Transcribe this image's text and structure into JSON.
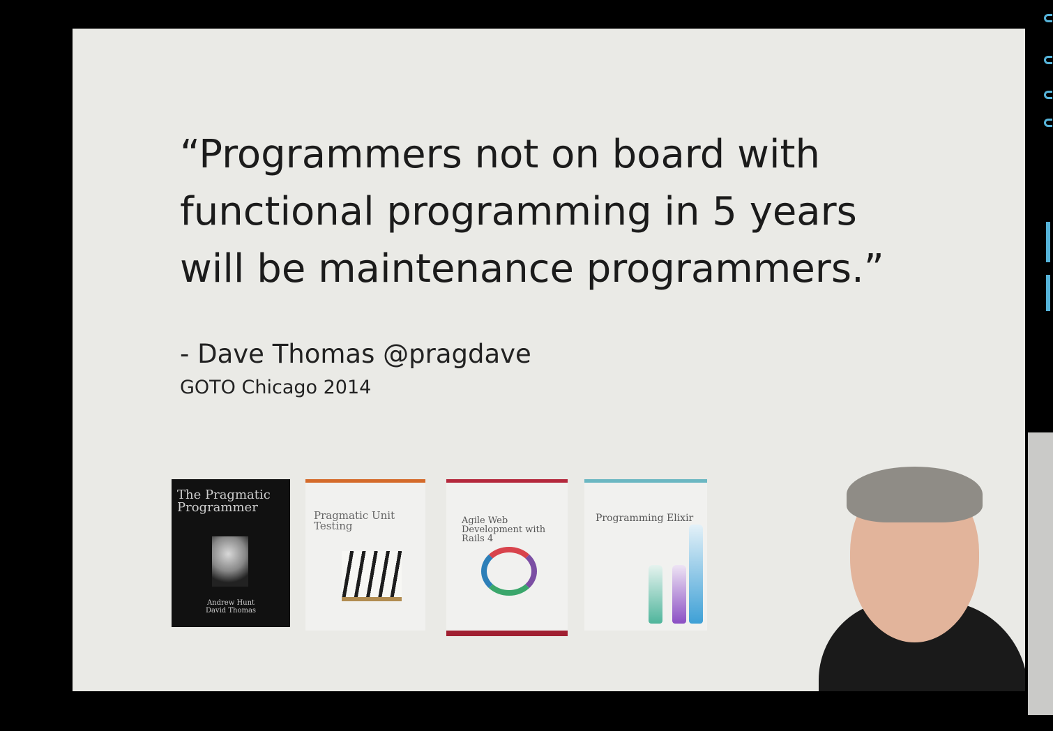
{
  "slide": {
    "quote_lines": [
      "“Programmers not on board with",
      "functional programming in 5 years",
      "will be maintenance programmers.”"
    ],
    "author": "- Dave Thomas @pragdave",
    "event": "GOTO Chicago 2014"
  },
  "books": [
    {
      "title": "The Pragmatic Programmer",
      "authors": "Andrew Hunt David Thomas"
    },
    {
      "title": "Pragmatic Unit Testing"
    },
    {
      "title": "Agile Web Development with Rails 4"
    },
    {
      "title": "Programming Elixir"
    }
  ],
  "colors": {
    "background": "#000000",
    "slide": "#eaeae6",
    "text": "#1b1b1b",
    "accent": "#56b3d9"
  }
}
